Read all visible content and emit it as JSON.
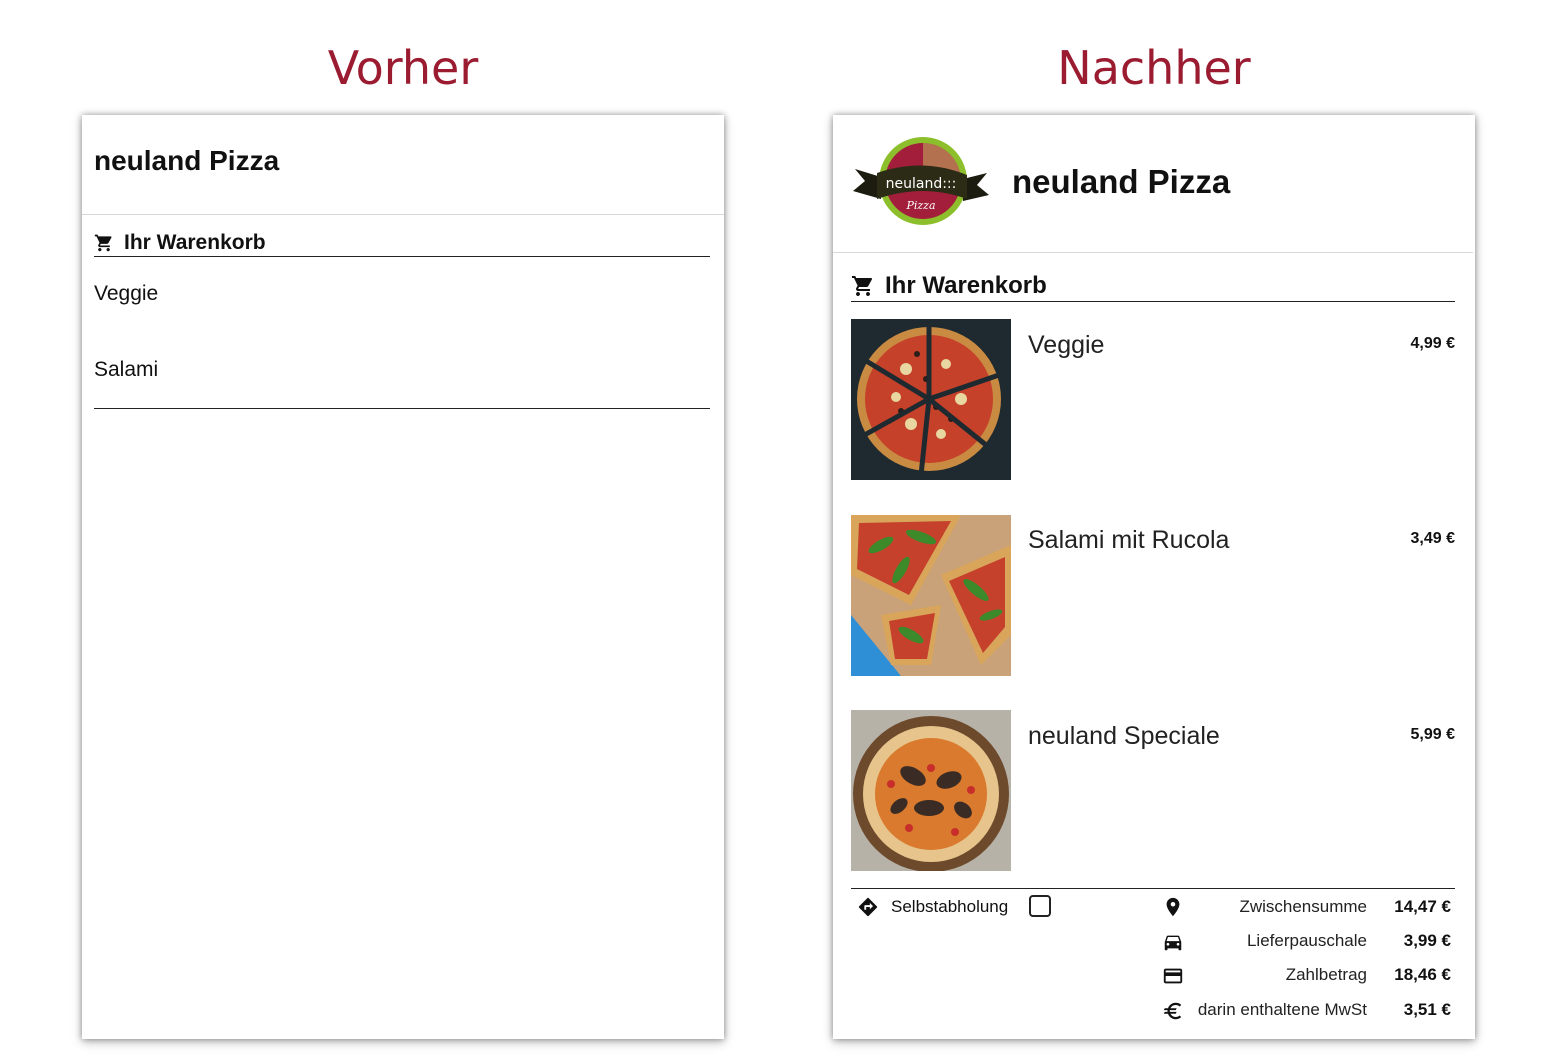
{
  "headings": {
    "before": "Vorher",
    "after": "Nachher"
  },
  "before": {
    "shop_title": "neuland Pizza",
    "cart_title": "Ihr Warenkorb",
    "items": [
      "Veggie",
      "Salami"
    ]
  },
  "after": {
    "logo": {
      "text": "neuland:::",
      "script": "Pizza"
    },
    "shop_title": "neuland Pizza",
    "cart_title": "Ihr Warenkorb",
    "items": [
      {
        "name": "Veggie",
        "price": "4,99 €"
      },
      {
        "name": "Salami mit Rucola",
        "price": "3,49 €"
      },
      {
        "name": "neuland Speciale",
        "price": "5,99 €"
      }
    ],
    "pickup_label": "Selbstabholung",
    "pickup_checked": false,
    "summary": [
      {
        "icon": "map-pin-icon",
        "label": "Zwischensumme",
        "value": "14,47 €"
      },
      {
        "icon": "car-icon",
        "label": "Lieferpauschale",
        "value": "3,99 €"
      },
      {
        "icon": "credit-card-icon",
        "label": "Zahlbetrag",
        "value": "18,46 €"
      },
      {
        "icon": "euro-icon",
        "label": "darin enthaltene MwSt",
        "value": "3,51 €"
      }
    ]
  },
  "colors": {
    "heading": "#9b1c31",
    "logo_red": "#a21e3a",
    "logo_green": "#8cbf2b"
  }
}
